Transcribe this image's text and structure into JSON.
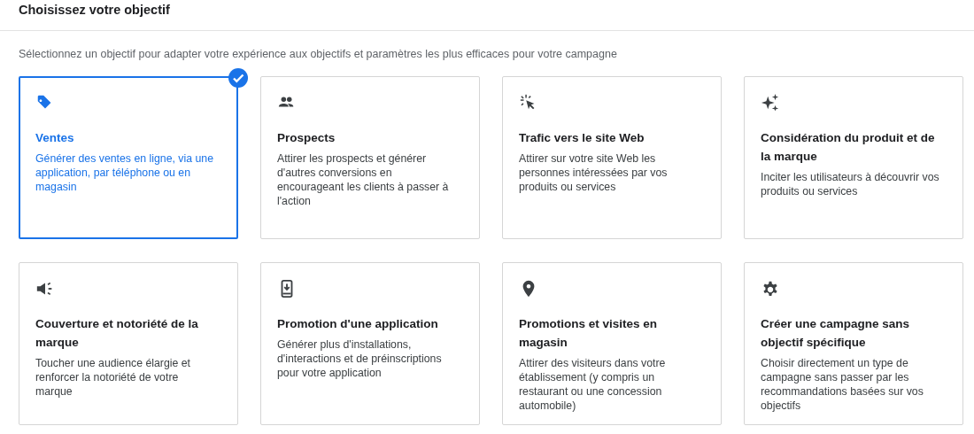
{
  "header": {
    "title": "Choisissez votre objectif"
  },
  "intro": "Sélectionnez un objectif pour adapter votre expérience aux objectifs et paramètres les plus efficaces pour votre campagne",
  "objectives": [
    {
      "title": "Ventes",
      "description": "Générer des ventes en ligne, via une application, par téléphone ou en magasin",
      "selected": true
    },
    {
      "title": "Prospects",
      "description": "Attirer les prospects et générer d'autres conversions en encourageant les clients à passer à l'action",
      "selected": false
    },
    {
      "title": "Trafic vers le site Web",
      "description": "Attirer sur votre site Web les personnes intéressées par vos produits ou services",
      "selected": false
    },
    {
      "title": "Considération du produit et de la marque",
      "description": "Inciter les utilisateurs à découvrir vos produits ou services",
      "selected": false
    },
    {
      "title": "Couverture et notoriété de la marque",
      "description": "Toucher une audience élargie et renforcer la notoriété de votre marque",
      "selected": false
    },
    {
      "title": "Promotion d'une application",
      "description": "Générer plus d'installations, d'interactions et de préinscriptions pour votre application",
      "selected": false
    },
    {
      "title": "Promotions et visites en magasin",
      "description": "Attirer des visiteurs dans votre établissement (y compris un restaurant ou une concession automobile)",
      "selected": false
    },
    {
      "title": "Créer une campagne sans objectif spécifique",
      "description": "Choisir directement un type de campagne sans passer par les recommandations basées sur vos objectifs",
      "selected": false
    }
  ]
}
